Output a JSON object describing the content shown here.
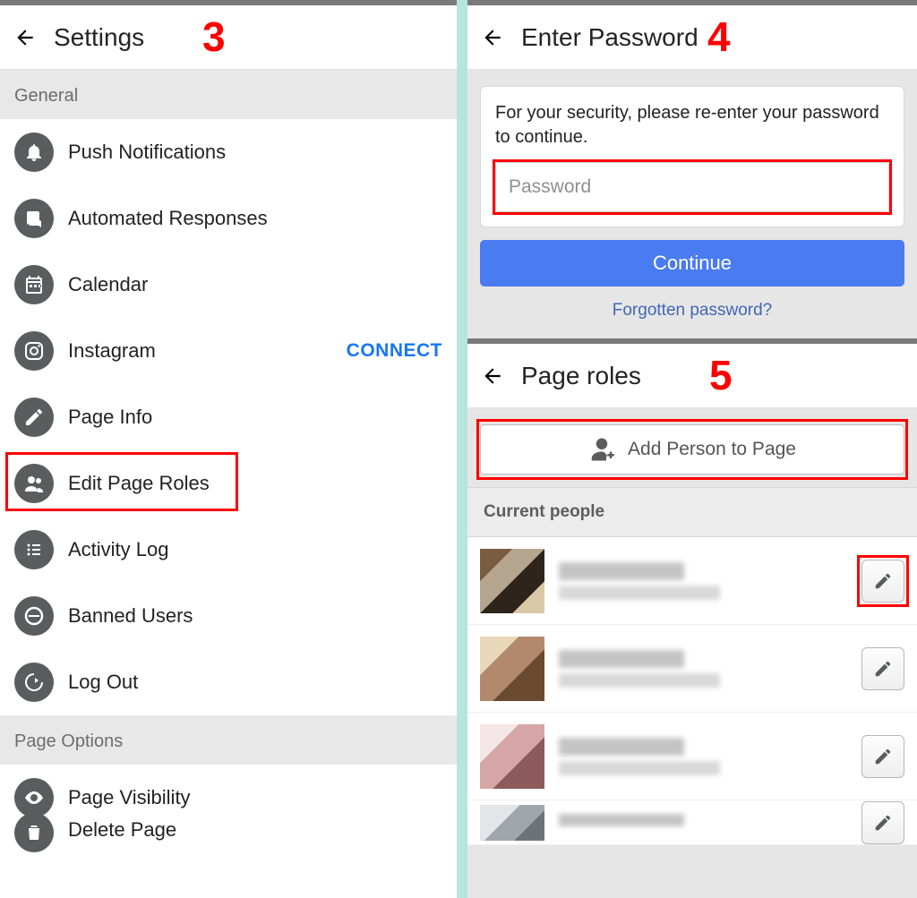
{
  "left": {
    "step": "3",
    "title": "Settings",
    "sections": {
      "general_label": "General",
      "page_options_label": "Page Options"
    },
    "items": {
      "push_notifications": "Push Notifications",
      "automated_responses": "Automated Responses",
      "calendar": "Calendar",
      "instagram": "Instagram",
      "instagram_action": "CONNECT",
      "page_info": "Page Info",
      "edit_page_roles": "Edit Page Roles",
      "activity_log": "Activity Log",
      "banned_users": "Banned Users",
      "log_out": "Log Out",
      "page_visibility": "Page Visibility",
      "delete_page": "Delete Page"
    }
  },
  "password": {
    "step": "4",
    "title": "Enter Password",
    "prompt": "For your security, please re-enter your password to continue.",
    "placeholder": "Password",
    "continue_label": "Continue",
    "forgot_label": "Forgotten password?"
  },
  "roles": {
    "step": "5",
    "title": "Page roles",
    "add_person_label": "Add Person to Page",
    "current_people_label": "Current people"
  }
}
